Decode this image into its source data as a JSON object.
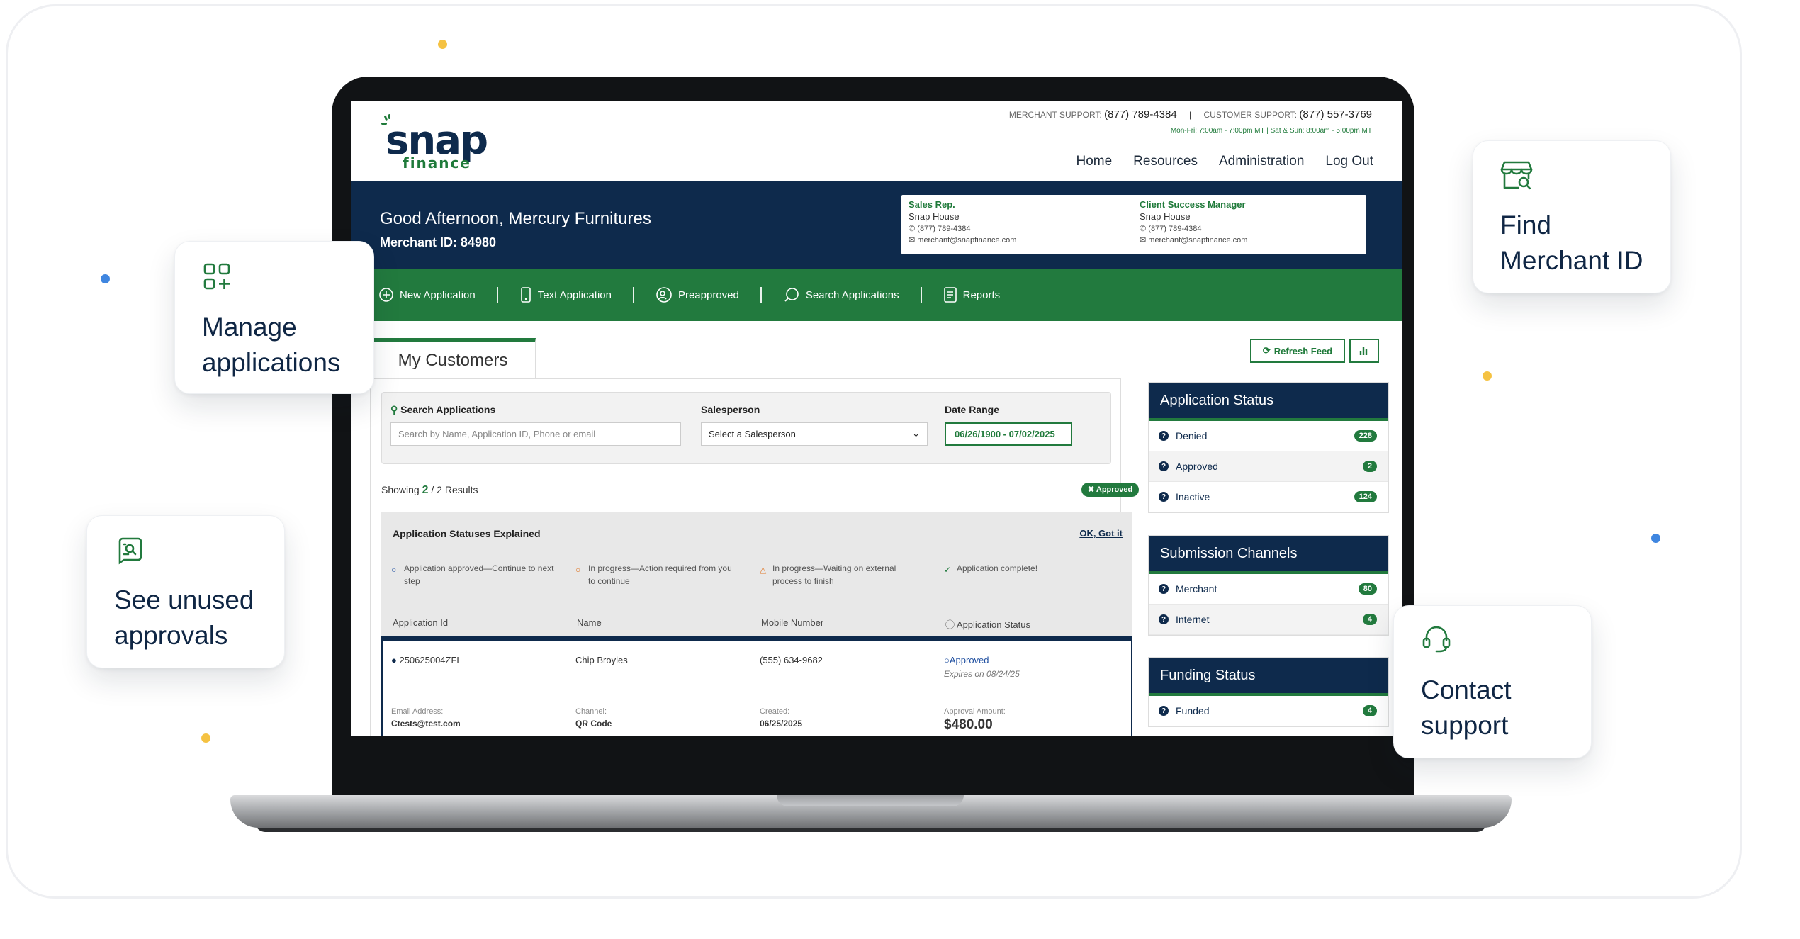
{
  "colors": {
    "navy": "#0e2a4c",
    "green": "#227a3e",
    "yellow_dot": "#f5c242",
    "blue_dot": "#3f86e0"
  },
  "header": {
    "logo_word": "snap",
    "logo_sub": "finance",
    "merchant_support_label": "MERCHANT SUPPORT:",
    "merchant_support_phone": "(877) 789-4384",
    "separator": "|",
    "customer_support_label": "CUSTOMER SUPPORT:",
    "customer_support_phone": "(877) 557-3769",
    "hours": "Mon-Fri: 7:00am - 7:00pm MT | Sat & Sun: 8:00am - 5:00pm MT",
    "nav": [
      "Home",
      "Resources",
      "Administration",
      "Log Out"
    ]
  },
  "banner": {
    "greeting": "Good Afternoon, Mercury Furnitures",
    "merchant_id": "Merchant ID: 84980",
    "sales_rep": {
      "title": "Sales Rep.",
      "name": "Snap House",
      "phone": "(877) 789-4384",
      "email": "merchant@snapfinance.com"
    },
    "csm": {
      "title": "Client Success Manager",
      "name": "Snap House",
      "phone": "(877) 789-4384",
      "email": "merchant@snapfinance.com"
    }
  },
  "actions": [
    {
      "label": "New Application",
      "icon": "plus-circle-icon"
    },
    {
      "label": "Text Application",
      "icon": "phone-icon"
    },
    {
      "label": "Preapproved",
      "icon": "user-badge-icon"
    },
    {
      "label": "Search Applications",
      "icon": "chat-search-icon"
    },
    {
      "label": "Reports",
      "icon": "report-icon"
    }
  ],
  "main": {
    "tab_label": "My Customers",
    "refresh_label": "Refresh Feed",
    "search_label": "Search Applications",
    "search_placeholder": "Search by Name, Application ID, Phone or email",
    "salesperson_label": "Salesperson",
    "salesperson_value": "Select a Salesperson",
    "date_label": "Date Range",
    "date_value": "06/26/1900 - 07/02/2025",
    "showing_prefix": "Showing",
    "showing_count": "2",
    "showing_suffix": "/ 2 Results",
    "filter_pill": "Approved",
    "explained_title": "Application Statuses Explained",
    "explained_ok": "OK, Got it",
    "legend": [
      "Application approved—Continue to next step",
      "In progress—Action required from you to continue",
      "In progress—Waiting on external process to finish",
      "Application complete!"
    ],
    "columns": [
      "Application Id",
      "Name",
      "Mobile Number",
      "Application Status"
    ],
    "row": {
      "id": "250625004ZFL",
      "name": "Chip Broyles",
      "phone": "(555) 634-9682",
      "status": "Approved",
      "expires": "Expires on 08/24/25",
      "email_label": "Email Address:",
      "email": "Ctests@test.com",
      "channel_label": "Channel:",
      "channel": "QR Code",
      "created_label": "Created:",
      "created": "06/25/2025",
      "amount_label": "Approval Amount:",
      "amount": "$480.00"
    }
  },
  "widgets": {
    "status": {
      "title": "Application Status",
      "rows": [
        {
          "label": "Denied",
          "count": "228"
        },
        {
          "label": "Approved",
          "count": "2"
        },
        {
          "label": "Inactive",
          "count": "124"
        }
      ]
    },
    "channels": {
      "title": "Submission Channels",
      "rows": [
        {
          "label": "Merchant",
          "count": "80"
        },
        {
          "label": "Internet",
          "count": "4"
        }
      ]
    },
    "funding": {
      "title": "Funding Status",
      "rows": [
        {
          "label": "Funded",
          "count": "4"
        }
      ]
    }
  },
  "callouts": {
    "manage": "Manage applications",
    "unused": "See unused approvals",
    "merchant_id": "Find Merchant ID",
    "support": "Contact support"
  }
}
